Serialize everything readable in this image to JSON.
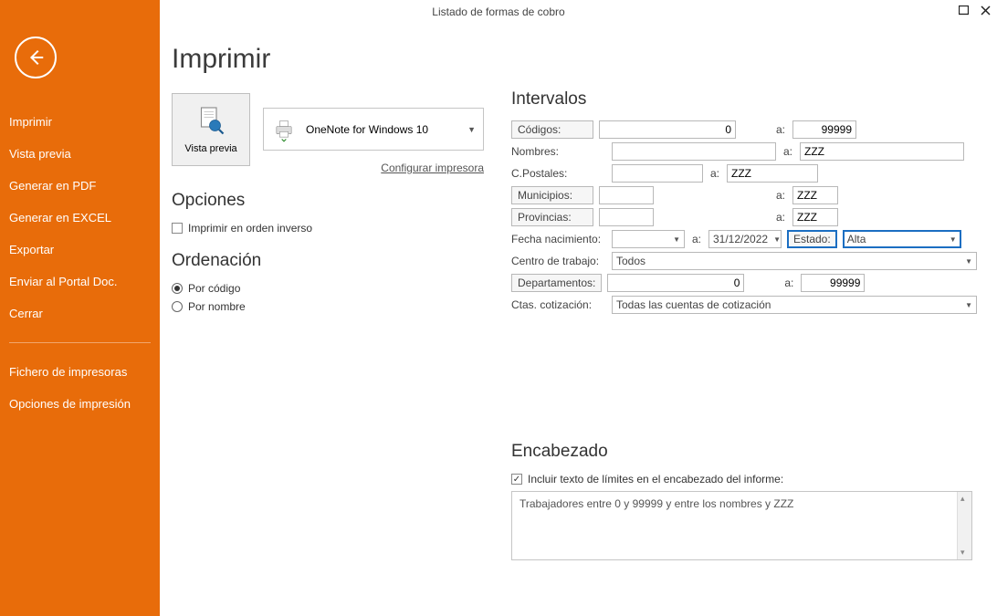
{
  "window": {
    "title": "Listado de formas de cobro"
  },
  "sidebar": {
    "items": [
      "Imprimir",
      "Vista previa",
      "Generar en PDF",
      "Generar en EXCEL",
      "Exportar",
      "Enviar al Portal Doc.",
      "Cerrar"
    ],
    "items2": [
      "Fichero de impresoras",
      "Opciones de impresión"
    ]
  },
  "page": {
    "title": "Imprimir",
    "preview_label": "Vista previa",
    "printer": "OneNote for Windows 10",
    "config_link": "Configurar impresora",
    "opciones_title": "Opciones",
    "reverse_label": "Imprimir en orden inverso",
    "ordenacion_title": "Ordenación",
    "por_codigo": "Por código",
    "por_nombre": "Por nombre"
  },
  "intervals": {
    "title": "Intervalos",
    "a": "a:",
    "codigos_label": "Códigos:",
    "codigos_from": "0",
    "codigos_to": "99999",
    "nombres_label": "Nombres:",
    "nombres_from": "",
    "nombres_to": "ZZZ",
    "cpostales_label": "C.Postales:",
    "cpostales_from": "",
    "cpostales_to": "ZZZ",
    "municipios_label": "Municipios:",
    "municipios_from": "",
    "municipios_to": "ZZZ",
    "provincias_label": "Provincias:",
    "provincias_from": "",
    "provincias_to": "ZZZ",
    "fecha_label": "Fecha nacimiento:",
    "fecha_from": "",
    "fecha_to": "31/12/2022",
    "estado_label": "Estado:",
    "estado_value": "Alta",
    "centro_label": "Centro de trabajo:",
    "centro_value": "Todos",
    "deptos_label": "Departamentos:",
    "deptos_from": "0",
    "deptos_to": "99999",
    "ctas_label": "Ctas. cotización:",
    "ctas_value": "Todas las cuentas de cotización"
  },
  "encabezado": {
    "title": "Encabezado",
    "checkbox_label": "Incluir texto de límites en el encabezado del informe:",
    "text": "Trabajadores entre 0 y 99999 y entre los nombres  y ZZZ"
  }
}
